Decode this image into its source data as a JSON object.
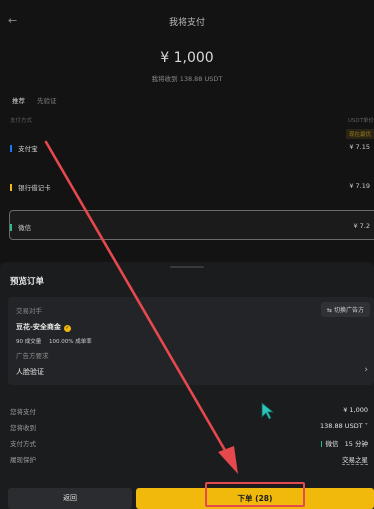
{
  "header": {
    "title": "我将支付"
  },
  "payment": {
    "amount": "¥ 1,000",
    "receive_text": "我将收到 138.88 USDT"
  },
  "tabs": [
    {
      "label": "推荐"
    },
    {
      "label": "先验证"
    }
  ],
  "columns": {
    "left": "支付方式",
    "right": "USDT单价"
  },
  "badge": "现在最优",
  "methods": [
    {
      "name": "支付宝",
      "rate": "¥ 7.15",
      "color": "#1677ff"
    },
    {
      "name": "银行借记卡",
      "rate": "¥ 7.19",
      "color": "#f0b90b"
    },
    {
      "name": "微信",
      "rate": "¥ 7.2",
      "color": "#2ebd85"
    }
  ],
  "sheet": {
    "title": "预览订单",
    "card_label": "交易对手",
    "switch_label": "切换广告方",
    "merchant": "豆花-安全商金",
    "stats": {
      "trades": "90 成交量",
      "rate": "100.00% 成单率"
    },
    "ad_requirements_label": "广告方要求",
    "face_verify": "人脸验证",
    "rows": [
      {
        "label": "您将支付",
        "value": "¥ 1,000"
      },
      {
        "label": "您将收到",
        "value": "138.88 USDT"
      },
      {
        "label": "支付方式",
        "value": "微信",
        "extra": "15 分钟"
      },
      {
        "label": "履现保护",
        "value": "交易之星"
      }
    ]
  },
  "actions": {
    "back": "返回",
    "order": "下单 (28)"
  }
}
